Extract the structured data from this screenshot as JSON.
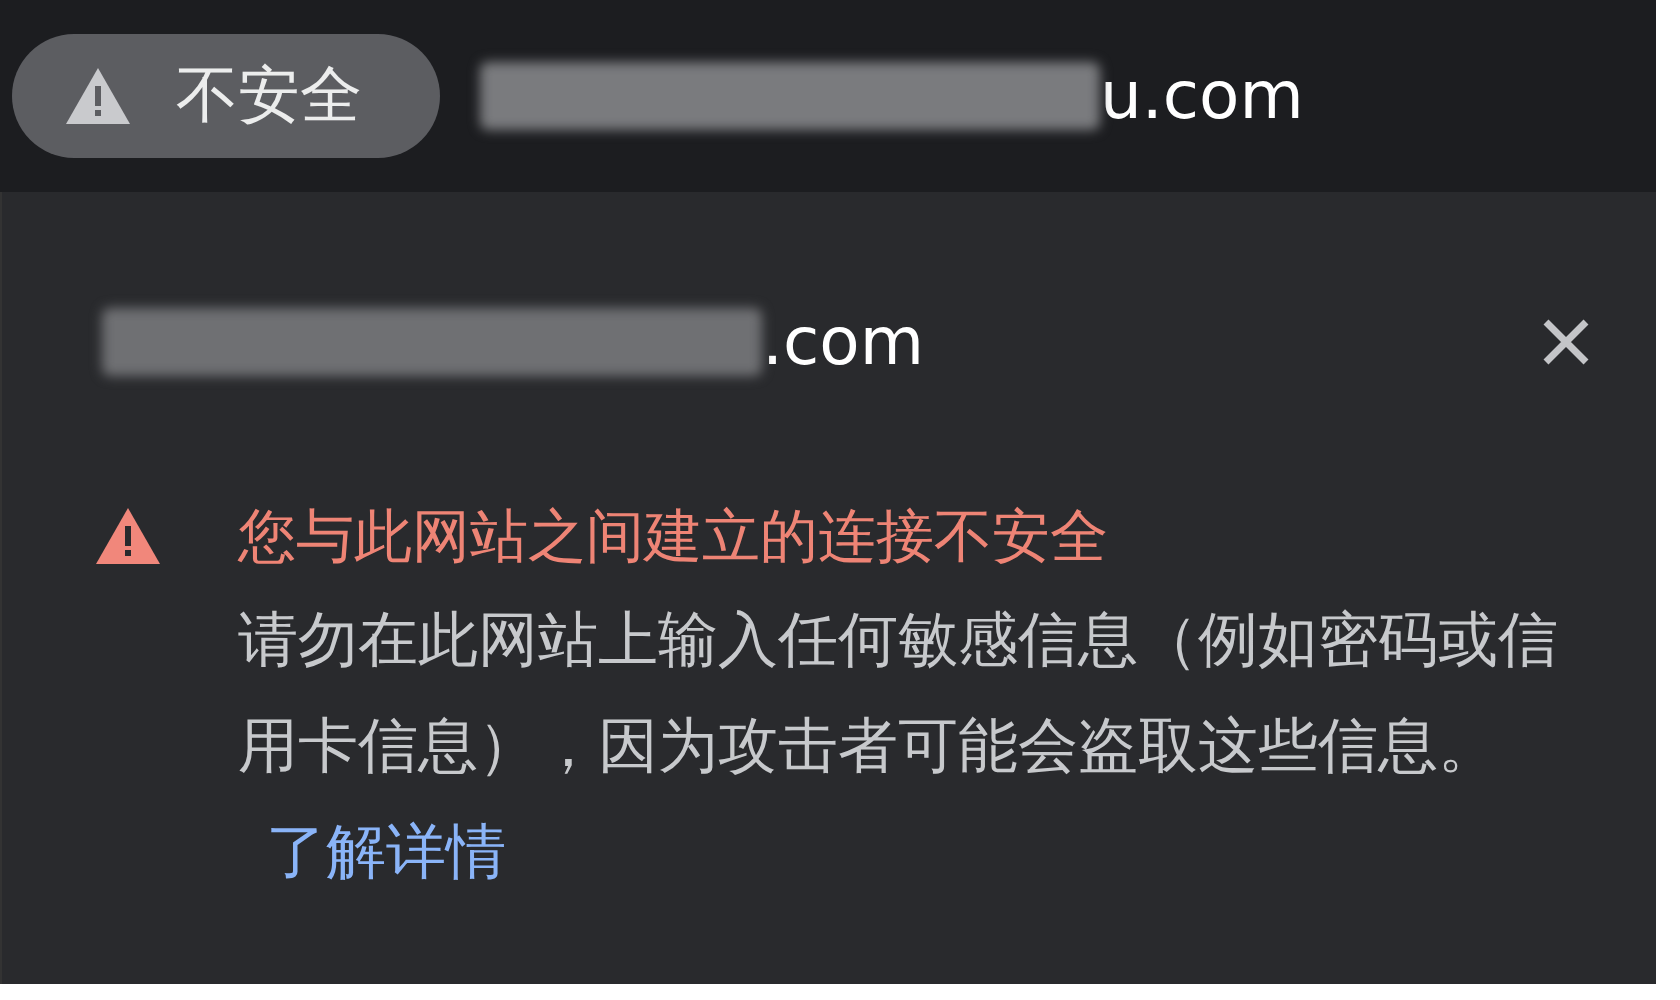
{
  "address_bar": {
    "security_chip": {
      "label": "不安全"
    },
    "url_visible_part": "u.com"
  },
  "popup": {
    "site_visible_part": ".com",
    "heading": "您与此网站之间建立的连接不安全",
    "body": "请勿在此网站上输入任何敏感信息（例如密码或信用卡信息），因为攻击者可能会盗取这些信息。",
    "link": "了解详情"
  }
}
